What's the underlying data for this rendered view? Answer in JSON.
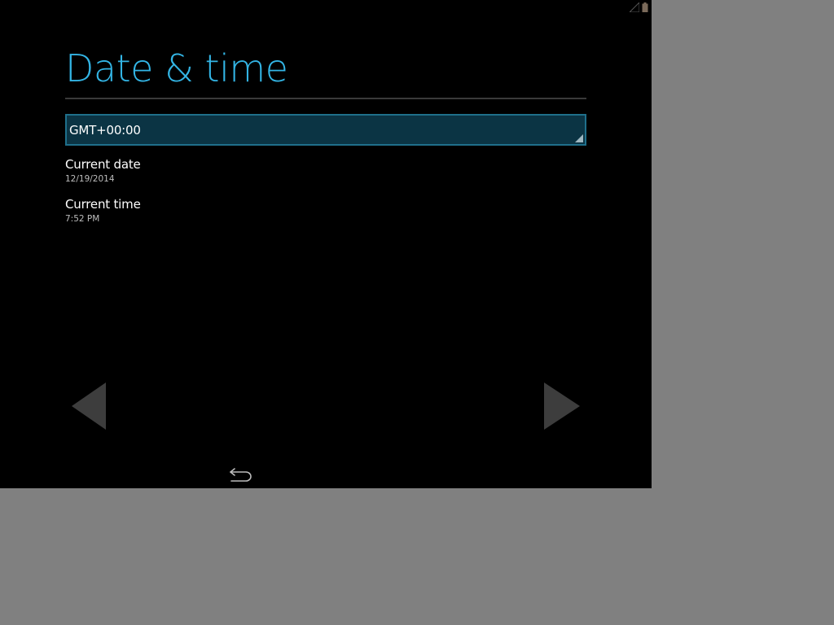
{
  "colors": {
    "accent": "#33b5e5",
    "screen_background": "#000000",
    "outside_background": "#808080",
    "spinner_fill": "#0b3444",
    "spinner_border": "#1f6f8b"
  },
  "status_bar": {
    "icons": [
      "signal-icon",
      "battery-icon"
    ]
  },
  "header": {
    "title": "Date & time"
  },
  "timezone": {
    "value": "GMT+00:00"
  },
  "preferences": {
    "date": {
      "title": "Current date",
      "summary": "12/19/2014"
    },
    "time": {
      "title": "Current time",
      "summary": "7:52 PM"
    }
  },
  "navigation": {
    "prev_icon": "left-arrow-icon",
    "next_icon": "right-arrow-icon",
    "back_icon": "back-icon"
  }
}
